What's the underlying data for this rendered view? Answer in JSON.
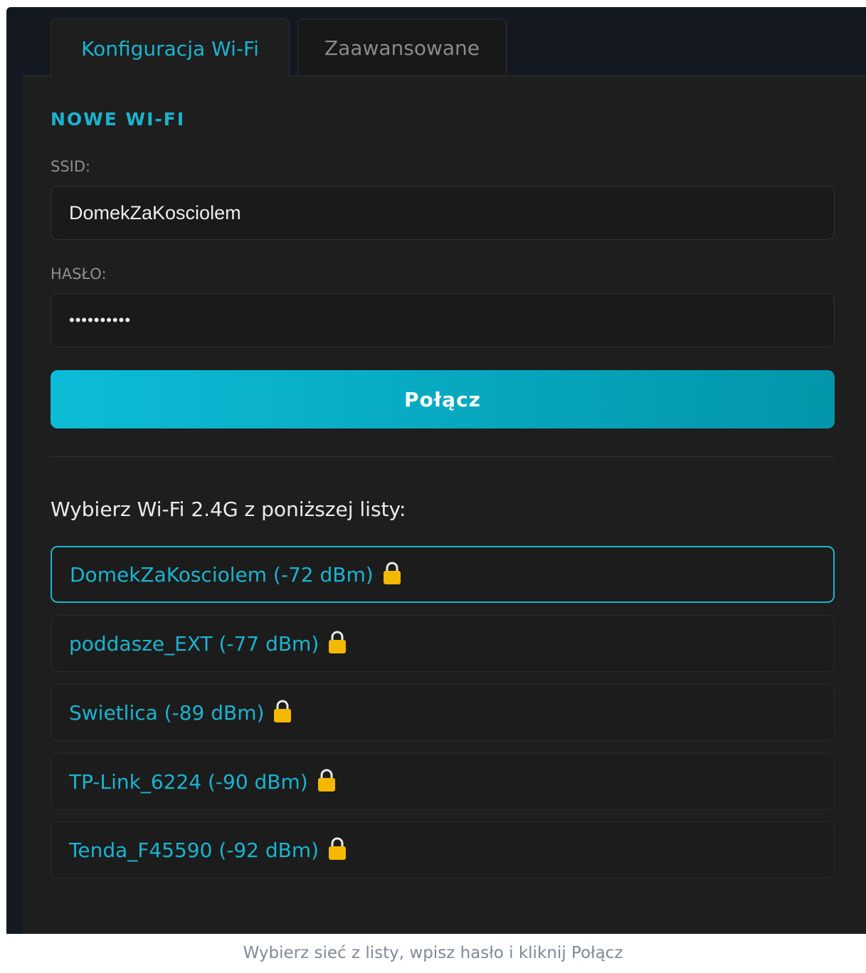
{
  "tabs": [
    {
      "label": "Konfiguracja Wi-Fi",
      "active": true
    },
    {
      "label": "Zaawansowane",
      "active": false
    }
  ],
  "form": {
    "section_title": "NOWE WI-FI",
    "ssid_label": "SSID:",
    "ssid_value": "DomekZaKosciolem",
    "password_label": "HASŁO:",
    "password_value": "••••••••••",
    "connect_label": "Połącz"
  },
  "network_list": {
    "heading": "Wybierz Wi-Fi 2.4G z poniższej listy:",
    "items": [
      {
        "label": "DomekZaKosciolem (-72 dBm)",
        "icon": "lock-icon",
        "selected": true
      },
      {
        "label": "poddasze_EXT (-77 dBm)",
        "icon": "lock-icon",
        "selected": false
      },
      {
        "label": "Swietlica (-89 dBm)",
        "icon": "lock-icon",
        "selected": false
      },
      {
        "label": "TP-Link_6224 (-90 dBm)",
        "icon": "lock-icon",
        "selected": false
      },
      {
        "label": "Tenda_F45590 (-92 dBm)",
        "icon": "lock-icon",
        "selected": false
      }
    ]
  },
  "caption": "Wybierz sieć z listy, wpisz hasło i kliknij Połącz",
  "colors": {
    "accent": "#1ab4d0",
    "background": "#1e1e1e",
    "lock": "#f5b800"
  }
}
